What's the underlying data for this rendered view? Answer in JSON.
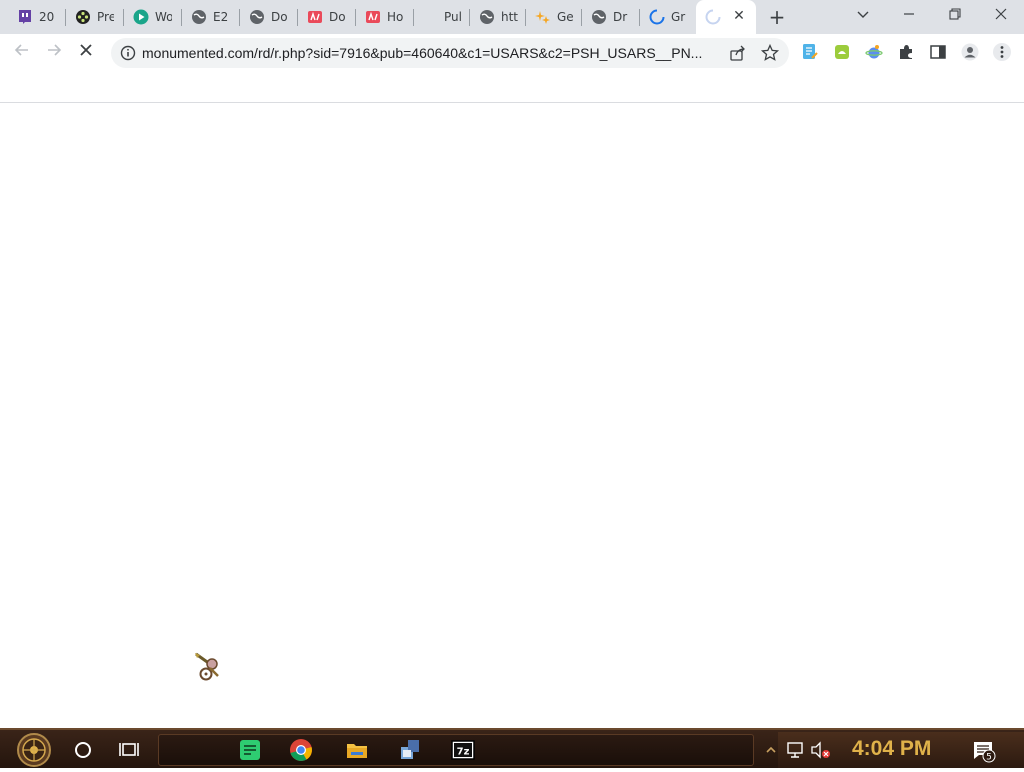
{
  "tabs": [
    {
      "title": "20",
      "icon": "twitch-icon"
    },
    {
      "title": "Pre",
      "icon": "film-reel-icon"
    },
    {
      "title": "Wo",
      "icon": "play-circle-icon"
    },
    {
      "title": "E2",
      "icon": "globe-icon"
    },
    {
      "title": "Do",
      "icon": "globe-icon"
    },
    {
      "title": "Do",
      "icon": "store-icon"
    },
    {
      "title": "Ho",
      "icon": "store-icon"
    },
    {
      "title": "Pul",
      "icon": "blank-icon"
    },
    {
      "title": "htt",
      "icon": "globe-icon"
    },
    {
      "title": "Ge",
      "icon": "sparkle-icon"
    },
    {
      "title": "Dr",
      "icon": "globe-icon"
    },
    {
      "title": "Gr",
      "icon": "loading-icon"
    },
    {
      "title": "",
      "icon": "loading-icon"
    }
  ],
  "address_bar": {
    "url": "monumented.com/rd/r.php?sid=7916&pub=460640&c1=USARS&c2=PSH_USARS__PN..."
  },
  "taskbar": {
    "clock": "4:04 PM",
    "notification_count": "5"
  },
  "colors": {
    "tabstrip": "#dee1e6",
    "taskbar": "#2c1a10",
    "clock": "#e0b24a"
  }
}
